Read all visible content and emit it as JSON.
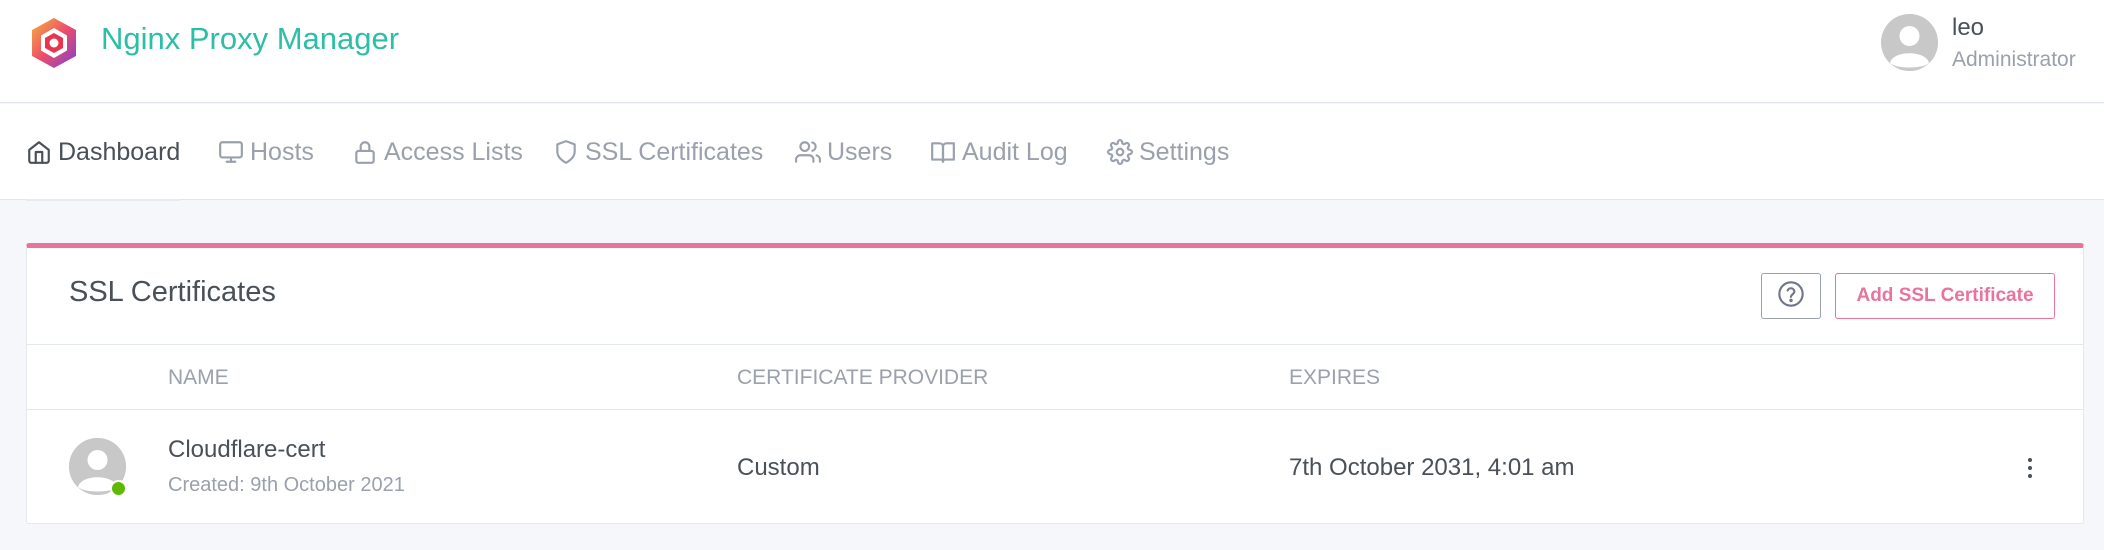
{
  "app": {
    "brand": "Nginx Proxy Manager",
    "brand_color": "#2cbea6",
    "logo_icon": "npm-logo-icon"
  },
  "user": {
    "name": "leo",
    "role": "Administrator",
    "avatar_icon": "user-avatar-icon"
  },
  "nav": {
    "items": [
      {
        "label": "Dashboard",
        "icon": "home-icon",
        "active": true
      },
      {
        "label": "Hosts",
        "icon": "monitor-icon"
      },
      {
        "label": "Access Lists",
        "icon": "lock-icon"
      },
      {
        "label": "SSL Certificates",
        "icon": "shield-icon"
      },
      {
        "label": "Users",
        "icon": "users-icon"
      },
      {
        "label": "Audit Log",
        "icon": "book-icon"
      },
      {
        "label": "Settings",
        "icon": "gear-icon"
      }
    ]
  },
  "card": {
    "title": "SSL Certificates",
    "accent_color": "#e8749a",
    "help_icon": "help-circle-icon",
    "add_button": "Add SSL Certificate",
    "columns": [
      "Name",
      "Certificate Provider",
      "Expires"
    ],
    "rows": [
      {
        "name": "Cloudflare-cert",
        "created": "Created: 9th October 2021",
        "provider": "Custom",
        "expires": "7th October 2031, 4:01 am",
        "status_color": "#5eba00"
      }
    ]
  }
}
